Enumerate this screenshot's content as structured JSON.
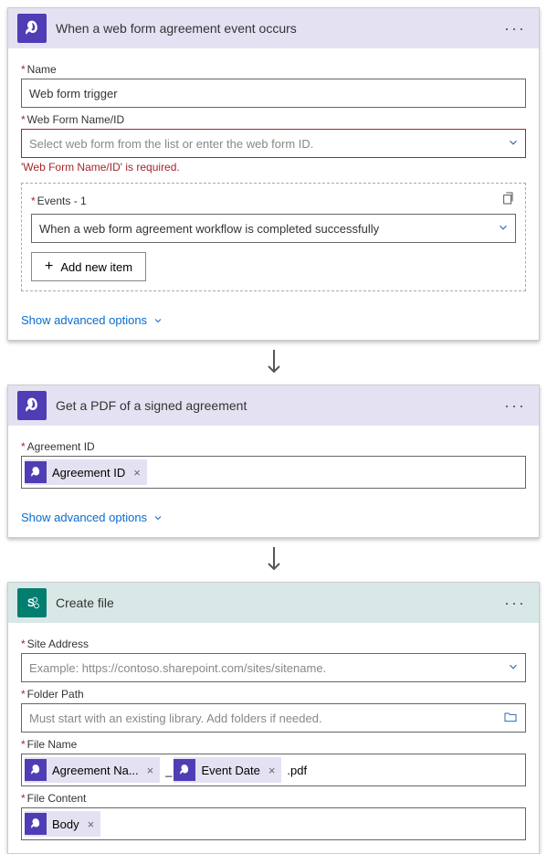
{
  "card1": {
    "title": "When a web form agreement event occurs",
    "name_label": "Name",
    "name_value": "Web form trigger",
    "webform_label": "Web Form Name/ID",
    "webform_placeholder": "Select web form from the list or enter the web form ID.",
    "webform_error": "'Web Form Name/ID' is required.",
    "events_label": "Events - 1",
    "events_value": "When a web form agreement workflow is completed successfully",
    "add_item": "Add new item",
    "advanced": "Show advanced options"
  },
  "card2": {
    "title": "Get a PDF of a signed agreement",
    "agreement_label": "Agreement ID",
    "token_agreement": "Agreement ID",
    "advanced": "Show advanced options"
  },
  "card3": {
    "title": "Create file",
    "site_label": "Site Address",
    "site_placeholder": "Example: https://contoso.sharepoint.com/sites/sitename.",
    "folder_label": "Folder Path",
    "folder_placeholder": "Must start with an existing library. Add folders if needed.",
    "filename_label": "File Name",
    "token_agname": "Agreement Na...",
    "sep": "_",
    "token_eventdate": "Event Date",
    "suffix": ".pdf",
    "filecontent_label": "File Content",
    "token_body": "Body"
  }
}
